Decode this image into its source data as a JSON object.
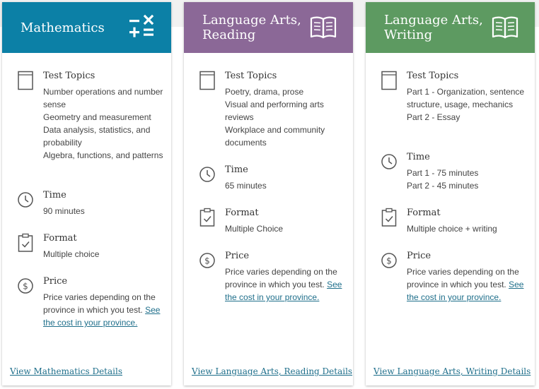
{
  "labels": {
    "topics": "Test Topics",
    "time": "Time",
    "format": "Format",
    "price": "Price"
  },
  "colors": {
    "math": "#0c80a6",
    "reading": "#8b6897",
    "writing": "#5d9a61",
    "link": "#1f6f8b"
  },
  "cards": [
    {
      "title": "Mathematics",
      "header_icon": "math-operators-icon",
      "topics": [
        "Number operations and number sense",
        "Geometry and measurement",
        "Data analysis, statistics, and probability",
        "Algebra, functions, and patterns"
      ],
      "time": [
        "90 minutes"
      ],
      "format": [
        "Multiple choice"
      ],
      "price_text": "Price varies depending on the province in which you test.",
      "price_link": "See the cost in your province.",
      "details_link": "View Mathematics Details"
    },
    {
      "title": "Language Arts, Reading",
      "header_icon": "open-book-icon",
      "topics": [
        "Poetry, drama, prose",
        "Visual and performing arts reviews",
        "Workplace and community documents"
      ],
      "time": [
        "65 minutes"
      ],
      "format": [
        "Multiple Choice"
      ],
      "price_text": "Price varies depending on the province in which you test.",
      "price_link": "See the cost in your province.",
      "details_link": "View Language Arts, Reading Details"
    },
    {
      "title": "Language Arts, Writing",
      "header_icon": "open-book-icon",
      "topics": [
        "Part 1 - Organization, sentence structure, usage, mechanics",
        "Part 2 - Essay"
      ],
      "time": [
        "Part 1 - 75 minutes",
        "Part 2 - 45 minutes"
      ],
      "format": [
        "Multiple choice + writing"
      ],
      "price_text": "Price varies depending on the province in which you test.",
      "price_link": "See the cost in your province.",
      "details_link": "View Language Arts, Writing Details"
    }
  ]
}
